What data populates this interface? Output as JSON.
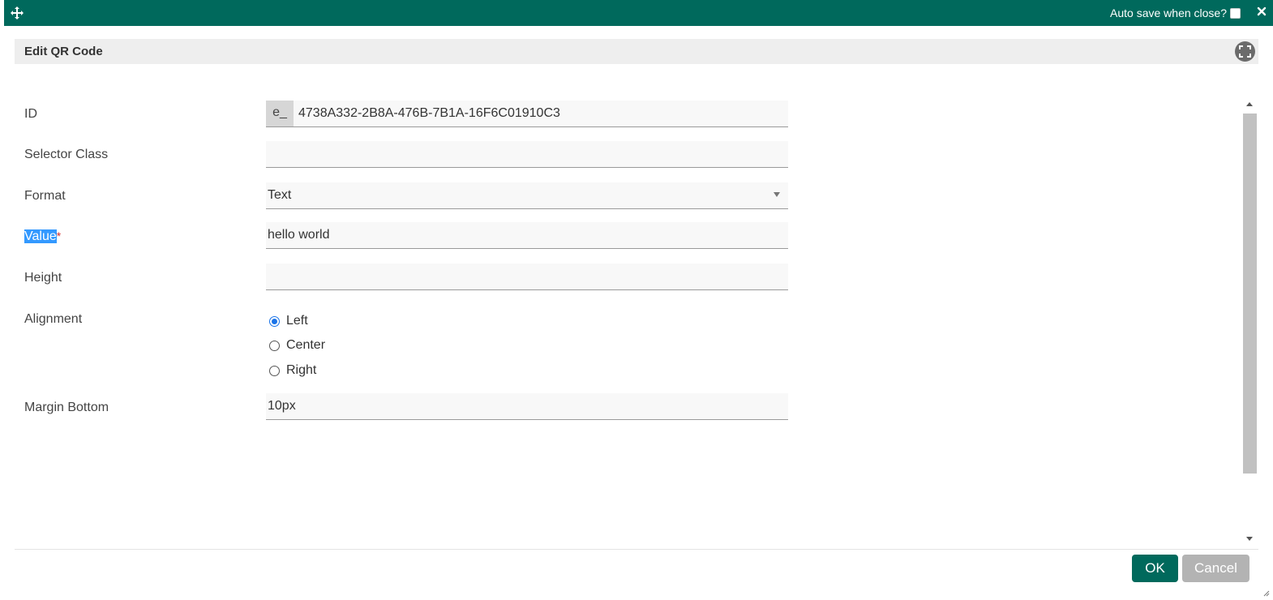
{
  "titlebar": {
    "autosave_label": "Auto save when close?",
    "move_icon": "move-arrows-icon",
    "close_icon": "close-icon",
    "color": "#00695c"
  },
  "dialog": {
    "title": "Edit QR Code",
    "fullscreen_icon": "fullscreen-icon"
  },
  "form": {
    "id": {
      "label": "ID",
      "prefix": "e_",
      "value": "4738A332-2B8A-476B-7B1A-16F6C01910C3"
    },
    "selector_class": {
      "label": "Selector Class",
      "value": ""
    },
    "format": {
      "label": "Format",
      "value": "Text"
    },
    "value": {
      "label": "Value",
      "required_mark": "*",
      "value": "hello world"
    },
    "height": {
      "label": "Height",
      "value": ""
    },
    "alignment": {
      "label": "Alignment",
      "options": [
        "Left",
        "Center",
        "Right"
      ],
      "selected": "Left"
    },
    "margin_bottom": {
      "label": "Margin Bottom",
      "value": "10px"
    }
  },
  "footer": {
    "ok_label": "OK",
    "cancel_label": "Cancel",
    "ok_color": "#00695c",
    "cancel_color": "#b3b3b3"
  }
}
